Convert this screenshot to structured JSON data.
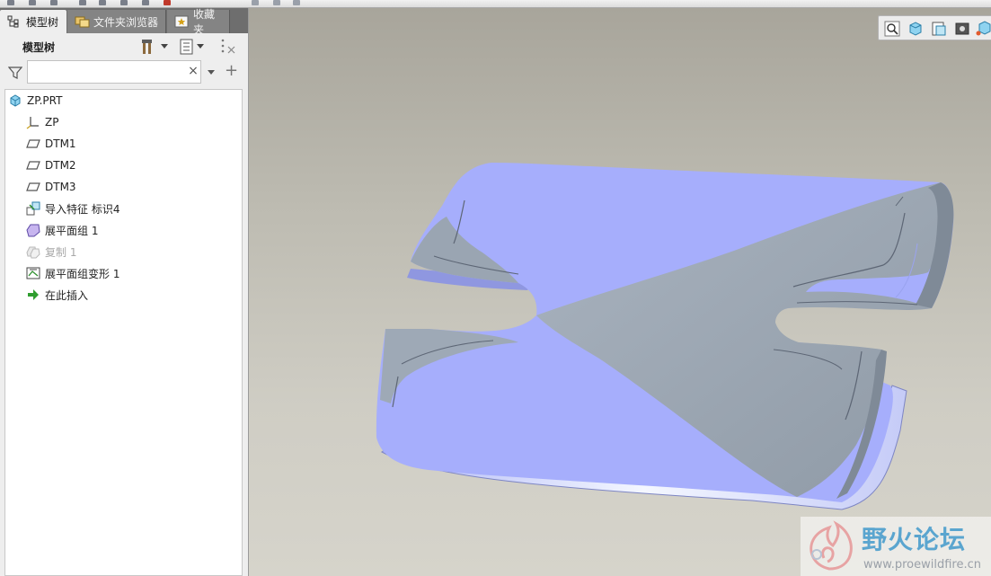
{
  "tabs": [
    {
      "label": "模型树",
      "icon": "model-tree-icon",
      "active": true
    },
    {
      "label": "文件夹浏览器",
      "icon": "folder-browser-icon",
      "active": false
    },
    {
      "label": "收藏夹",
      "icon": "favorites-icon",
      "active": false
    }
  ],
  "tree_header": {
    "label": "模型树"
  },
  "filter": {
    "value": "",
    "placeholder": ""
  },
  "tree": {
    "items": [
      {
        "label": "ZP.PRT",
        "icon": "part-icon"
      },
      {
        "label": "ZP",
        "icon": "csys-icon"
      },
      {
        "label": "DTM1",
        "icon": "datum-plane-icon"
      },
      {
        "label": "DTM2",
        "icon": "datum-plane-icon"
      },
      {
        "label": "DTM3",
        "icon": "datum-plane-icon"
      },
      {
        "label": "导入特征 标识4",
        "icon": "import-feature-icon"
      },
      {
        "label": "展平面组 1",
        "icon": "flatten-quilt-icon"
      },
      {
        "label": "复制 1",
        "icon": "copy-icon",
        "suppressed": true
      },
      {
        "label": "展平面组变形 1",
        "icon": "flatten-deform-icon"
      },
      {
        "label": "在此插入",
        "icon": "insert-here-icon"
      }
    ]
  },
  "colors": {
    "surface_blue": "#a6aefc",
    "surface_gray": "#9aa6b3",
    "viewport_top": "#a8a59b",
    "viewport_bottom": "#d6d4cb"
  },
  "watermark": {
    "name": "野火论坛",
    "url": "www.proewildfire.cn"
  }
}
